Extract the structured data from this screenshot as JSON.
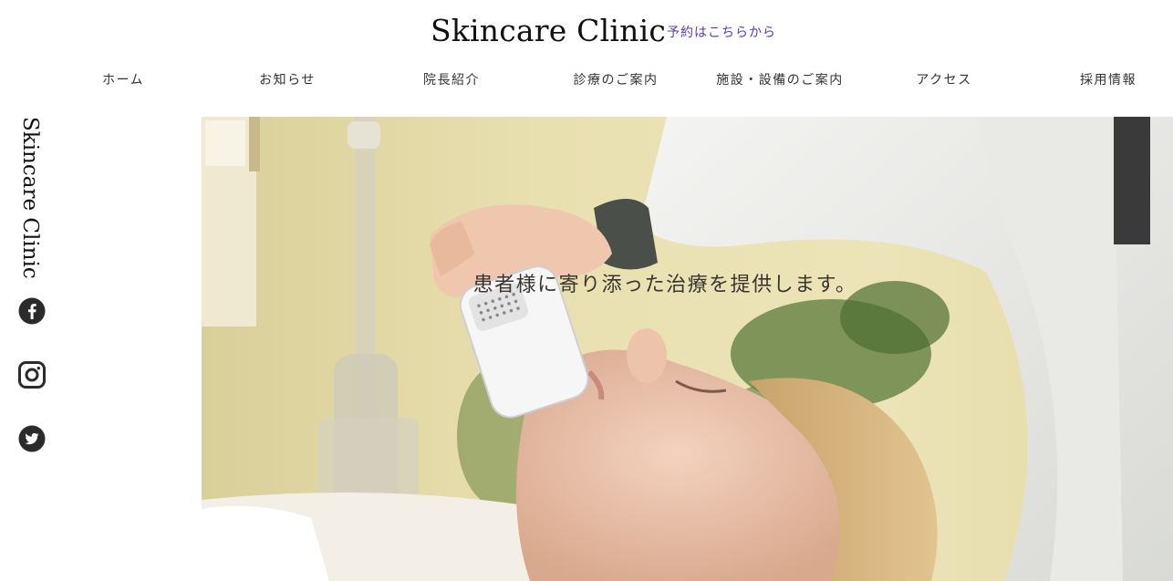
{
  "header": {
    "site_title": "Skincare Clinic",
    "reserve_link": "予約はこちらから"
  },
  "nav": {
    "items": [
      {
        "label": "ホーム"
      },
      {
        "label": "お知らせ"
      },
      {
        "label": "院長紹介"
      },
      {
        "label": "診療のご案内"
      },
      {
        "label": "施設・設備のご案内"
      },
      {
        "label": "アクセス"
      },
      {
        "label": "採用情報"
      }
    ]
  },
  "sidebar": {
    "vertical_title": "Skincare Clinic",
    "social": [
      {
        "icon": "facebook-icon"
      },
      {
        "icon": "instagram-icon"
      },
      {
        "icon": "twitter-icon"
      }
    ]
  },
  "hero": {
    "tagline": "患者様に寄り添った治療を提供します。",
    "image": "photo of a skincare treatment: clinician holding a handheld device against a patient's chin"
  },
  "colors": {
    "accent": "#5a3fa8",
    "text": "#222222",
    "hero_bg": "#e8dfb0"
  }
}
